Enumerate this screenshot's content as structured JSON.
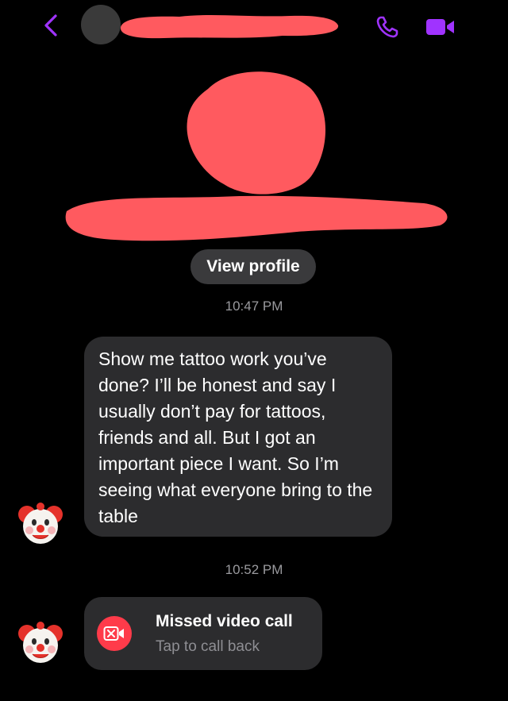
{
  "header": {
    "back_icon": "chevron-left-icon",
    "call_icon": "phone-icon",
    "video_icon": "video-camera-icon",
    "accent_color": "#a033ff"
  },
  "redaction_color": "#ff5a5f",
  "profile": {
    "view_profile_label": "View profile"
  },
  "messages": {
    "timestamp_1": "10:47 PM",
    "bubble_text": "Show me tattoo work you’ve done? I’ll be honest and say I usually don’t pay for tattoos, friends and all. But I got an important piece I want. So I’m seeing what everyone bring to the table",
    "timestamp_2": "10:52 PM",
    "missed_call_title": "Missed video call",
    "missed_call_subtitle": "Tap to call back",
    "missed_call_icon": "missed-video-call-icon",
    "missed_call_color": "#ff3b4a"
  },
  "sender_avatar_icon": "clown-face-icon"
}
